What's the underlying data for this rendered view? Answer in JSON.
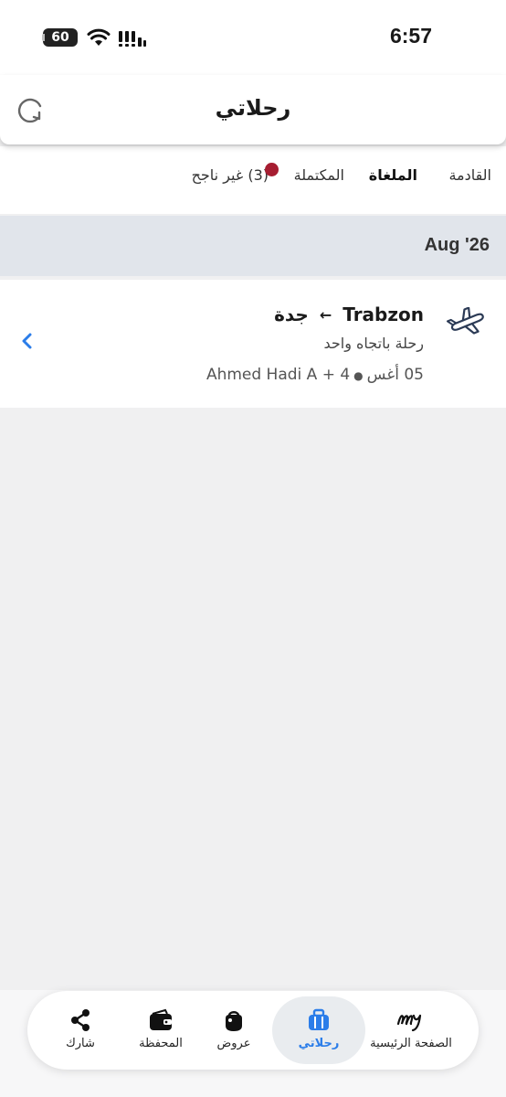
{
  "status_bar": {
    "time": "6:57",
    "battery": "60"
  },
  "header": {
    "title": "رحلاتي"
  },
  "tabs": [
    {
      "label": "القادمة",
      "active": false
    },
    {
      "label": "الملغاة",
      "active": true
    },
    {
      "label": "المكتملة",
      "active": false
    },
    {
      "label": "(3) غير ناجح",
      "active": false
    }
  ],
  "month_group": {
    "label": "Aug '26"
  },
  "trip": {
    "origin": "Trabzon",
    "arrow": "←",
    "destination": "جدة",
    "type": "رحلة باتجاه واحد",
    "date": "05 أغس",
    "passengers": "Ahmed Hadi A + 4"
  },
  "bottom_nav": {
    "home": "الصفحة الرئيسية",
    "trips": "رحلاتي",
    "offers": "عروض",
    "wallet": "المحفظة",
    "share": "شارك"
  },
  "colors": {
    "accent": "#2b7de9",
    "notification": "#a61d31",
    "month_band": "#e1e5eb"
  }
}
